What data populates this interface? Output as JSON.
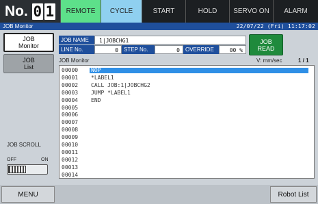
{
  "status_bar": {
    "unit_label": "No.",
    "unit_digits": [
      "0",
      "1"
    ],
    "cells": [
      {
        "key": "remote",
        "label": "REMOTE"
      },
      {
        "key": "cycle",
        "label": "CYCLE"
      },
      {
        "key": "start",
        "label": "START"
      },
      {
        "key": "hold",
        "label": "HOLD"
      },
      {
        "key": "servo_on",
        "label": "SERVO ON"
      },
      {
        "key": "alarm",
        "label": "ALARM"
      }
    ]
  },
  "title_bar": {
    "title": "JOB Monitor",
    "datetime": "22/07/22 (Fri) 11:17:02"
  },
  "nav": {
    "job_monitor": "JOB\nMonitor",
    "job_list": "JOB\nList"
  },
  "job_info": {
    "job_name_label": "JOB NAME",
    "job_name": "1|JOBCHG1",
    "line_no_label": "LINE No.",
    "line_no": "0",
    "step_no_label": "STEP No.",
    "step_no": "0",
    "override_label": "OVERRIDE",
    "override": "00 %",
    "job_read_label": "JOB\nREAD"
  },
  "monitor": {
    "label": "JOB Monitor",
    "speed_unit": "V: mm/sec",
    "page": "1 / 1",
    "lines": [
      {
        "no": "00000",
        "code": "NOP",
        "selected": true
      },
      {
        "no": "00001",
        "code": "*LABEL1",
        "selected": false
      },
      {
        "no": "00002",
        "code": "CALL JOB:1|JOBCHG2",
        "selected": false
      },
      {
        "no": "00003",
        "code": "JUMP *LABEL1",
        "selected": false
      },
      {
        "no": "00004",
        "code": "END",
        "selected": false
      },
      {
        "no": "00005",
        "code": "",
        "selected": false
      },
      {
        "no": "00006",
        "code": "",
        "selected": false
      },
      {
        "no": "00007",
        "code": "",
        "selected": false
      },
      {
        "no": "00008",
        "code": "",
        "selected": false
      },
      {
        "no": "00009",
        "code": "",
        "selected": false
      },
      {
        "no": "00010",
        "code": "",
        "selected": false
      },
      {
        "no": "00011",
        "code": "",
        "selected": false
      },
      {
        "no": "00012",
        "code": "",
        "selected": false
      },
      {
        "no": "00013",
        "code": "",
        "selected": false
      },
      {
        "no": "00014",
        "code": "",
        "selected": false
      }
    ]
  },
  "job_scroll": {
    "label": "JOB SCROLL",
    "off_label": "OFF",
    "on_label": "ON",
    "state": "OFF"
  },
  "bottom": {
    "menu": "MENU",
    "robot_list": "Robot List"
  },
  "colors": {
    "header_blue": "#1f4f9c",
    "remote_green": "#5de08a",
    "cycle_blue": "#8fd0f0",
    "job_read_green": "#1f8a3c",
    "selected_line": "#2f8fe6"
  }
}
